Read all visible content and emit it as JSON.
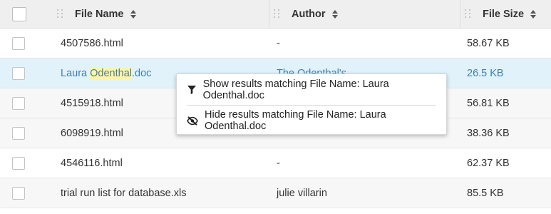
{
  "columns": {
    "name": "File Name",
    "author": "Author",
    "size": "File Size"
  },
  "rows": [
    {
      "name": "4507586.html",
      "author": "-",
      "size": "58.67 KB"
    },
    {
      "name_before": "Laura ",
      "name_highlight": "Odenthal",
      "name_after": ".doc",
      "author": "The Odenthal's",
      "size": "26.5 KB"
    },
    {
      "name": "4515918.html",
      "author": "",
      "size": "56.81 KB"
    },
    {
      "name": "6098919.html",
      "author": "",
      "size": "38.36 KB"
    },
    {
      "name": "4546116.html",
      "author": "-",
      "size": "62.37 KB"
    },
    {
      "name": "trial run list for database.xls",
      "author": "julie villarin",
      "size": "85.5 KB"
    }
  ],
  "context_menu": {
    "show_label": "Show results matching File Name: Laura Odenthal.doc",
    "hide_label": "Hide results matching File Name: Laura Odenthal.doc",
    "show_icon": "filter-icon",
    "hide_icon": "eye-slash-icon"
  },
  "colors": {
    "header_bg": "#efefef",
    "selected_row_bg": "#e1f2fb",
    "link": "#3f7fae",
    "highlight": "#fdf4a8"
  }
}
